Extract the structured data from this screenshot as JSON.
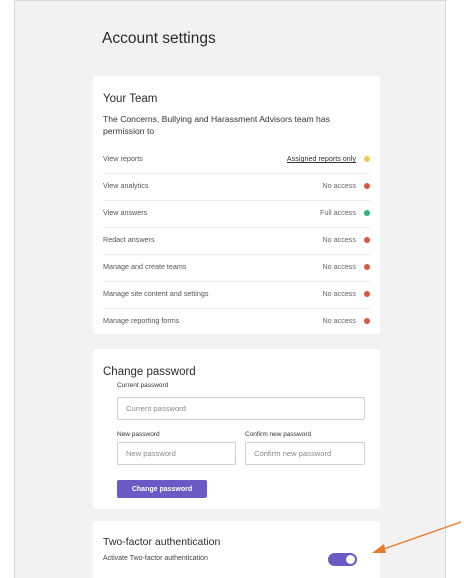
{
  "page": {
    "title": "Account settings"
  },
  "team": {
    "title": "Your Team",
    "description": "The Concerns, Bullying and Harassment Advisors team has permission to",
    "permissions": [
      {
        "label": "View reports",
        "value": "Assigned reports only",
        "status_color": "#f2c94c",
        "is_link": true
      },
      {
        "label": "View analytics",
        "value": "No access",
        "status_color": "#e2553b",
        "is_link": false
      },
      {
        "label": "View answers",
        "value": "Full access",
        "status_color": "#2bb673",
        "is_link": false
      },
      {
        "label": "Redact answers",
        "value": "No access",
        "status_color": "#e2553b",
        "is_link": false
      },
      {
        "label": "Manage and create teams",
        "value": "No access",
        "status_color": "#e2553b",
        "is_link": false
      },
      {
        "label": "Manage site content and settings",
        "value": "No access",
        "status_color": "#e2553b",
        "is_link": false
      },
      {
        "label": "Manage reporting forms",
        "value": "No access",
        "status_color": "#e2553b",
        "is_link": false
      }
    ]
  },
  "password": {
    "title": "Change password",
    "current_label": "Current password",
    "current_placeholder": "Current password",
    "new_label": "New password",
    "new_placeholder": "New password",
    "confirm_label": "Confirm new password",
    "confirm_placeholder": "Confirm new password",
    "button_label": "Change password"
  },
  "two_factor": {
    "title": "Two-factor authentication",
    "toggle_label": "Activate Two-factor authentication",
    "enabled": true
  },
  "colors": {
    "accent": "#6c5ac4",
    "annotation_arrow": "#e8792f"
  }
}
